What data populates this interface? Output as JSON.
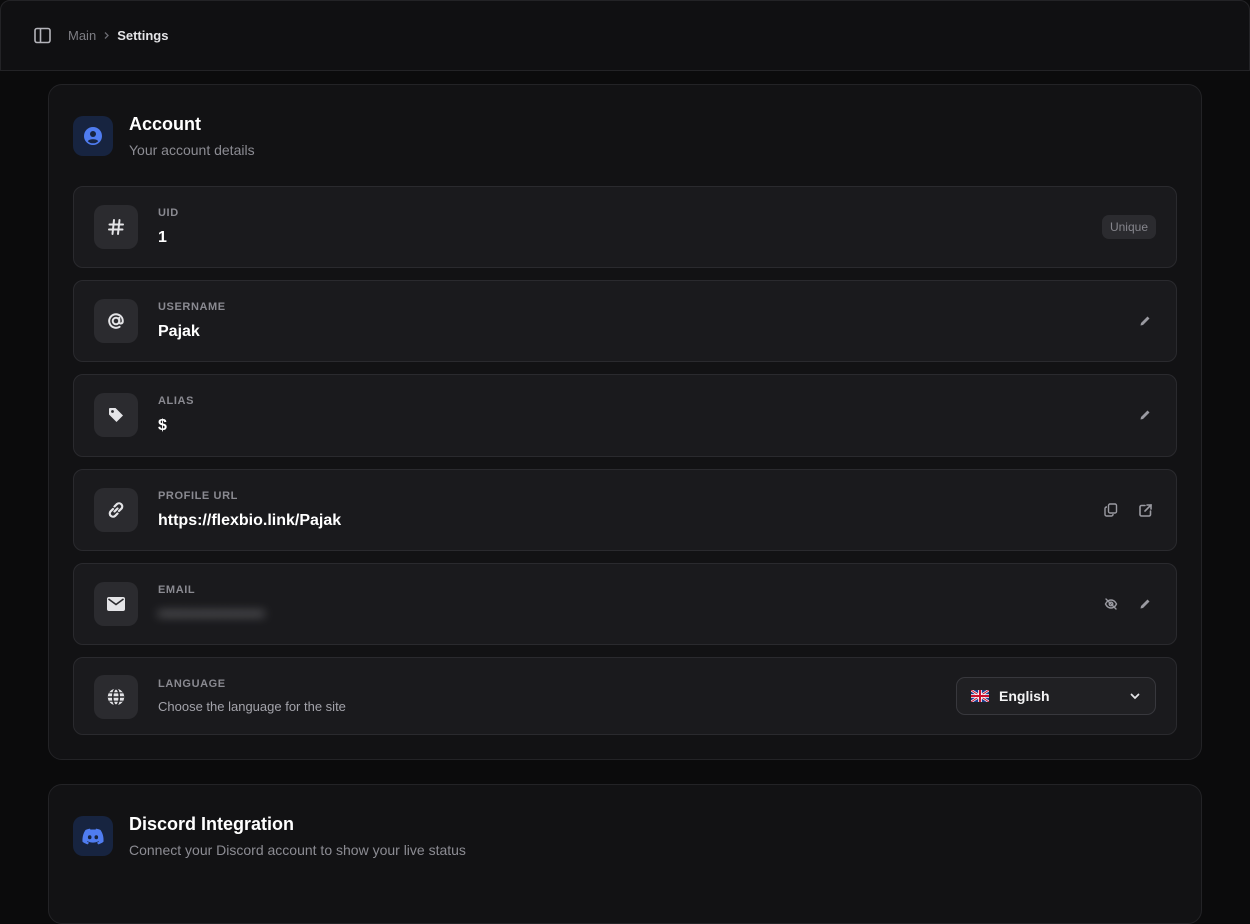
{
  "colors": {
    "accent": "#4f7cf0",
    "background": "#0b0b0c",
    "card": "#121214",
    "row": "#1a1a1d"
  },
  "breadcrumb": {
    "root": "Main",
    "current": "Settings"
  },
  "account": {
    "title": "Account",
    "subtitle": "Your account details",
    "icon": "user-circle-icon",
    "uid": {
      "label": "UID",
      "value": "1",
      "badge": "Unique",
      "icon": "hash-icon"
    },
    "username": {
      "label": "USERNAME",
      "value": "Pajak",
      "icon": "at-sign-icon"
    },
    "alias": {
      "label": "ALIAS",
      "value": "$",
      "icon": "tag-icon"
    },
    "profile_url": {
      "label": "PROFILE URL",
      "value": "https://flexbio.link/Pajak",
      "icon": "link-icon"
    },
    "email": {
      "label": "EMAIL",
      "value": "•••••••••••••••••••",
      "icon": "mail-icon"
    },
    "language": {
      "label": "LANGUAGE",
      "description": "Choose the language for the site",
      "selected": "English",
      "icon": "globe-icon"
    }
  },
  "discord": {
    "title": "Discord Integration",
    "subtitle": "Connect your Discord account to show your live status",
    "icon": "discord-icon"
  }
}
